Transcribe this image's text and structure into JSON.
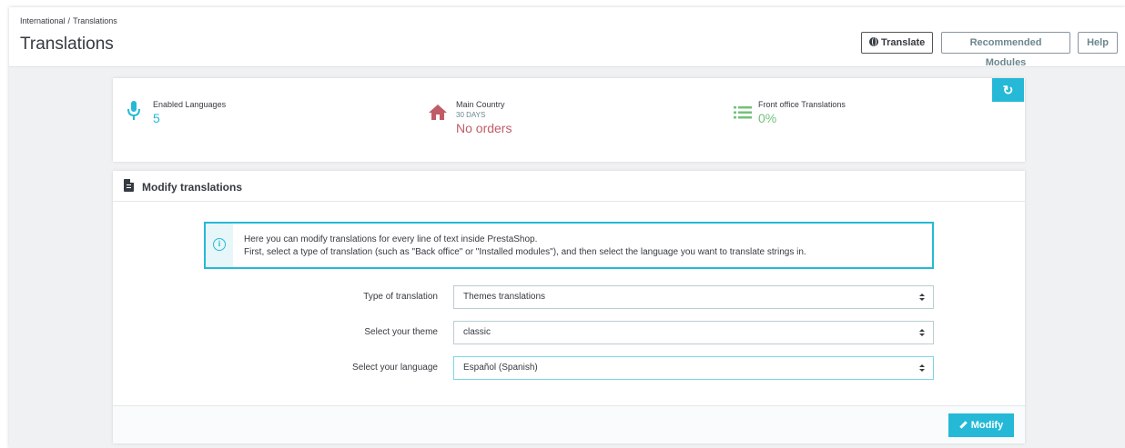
{
  "header": {
    "breadcrumb": [
      "International",
      "Translations"
    ],
    "breadcrumb_sep": "/",
    "title": "Translations",
    "buttons": {
      "translate": "Translate",
      "recommended": "Recommended Modules",
      "help": "Help"
    }
  },
  "kpis": {
    "refresh_icon": "refresh-icon",
    "items": [
      {
        "label": "Enabled Languages",
        "sub": "",
        "value": "5",
        "icon": "microphone-icon",
        "color": "#25b9d7"
      },
      {
        "label": "Main Country",
        "sub": "30 DAYS",
        "value": "No orders",
        "icon": "home-icon",
        "color": "#c05c67"
      },
      {
        "label": "Front office Translations",
        "sub": "",
        "value": "0%",
        "icon": "list-icon",
        "color": "#72c279"
      }
    ]
  },
  "panel": {
    "title": "Modify translations",
    "info": {
      "line1": "Here you can modify translations for every line of text inside PrestaShop.",
      "line2": "First, select a type of translation (such as \"Back office\" or \"Installed modules\"), and then select the language you want to translate strings in."
    },
    "fields": [
      {
        "label": "Type of translation",
        "value": "Themes translations"
      },
      {
        "label": "Select your theme",
        "value": "classic"
      },
      {
        "label": "Select your language",
        "value": "Español (Spanish)"
      }
    ],
    "submit": "Modify"
  },
  "colors": {
    "accent": "#25b9d7",
    "danger": "#c05c67",
    "success": "#72c279"
  }
}
